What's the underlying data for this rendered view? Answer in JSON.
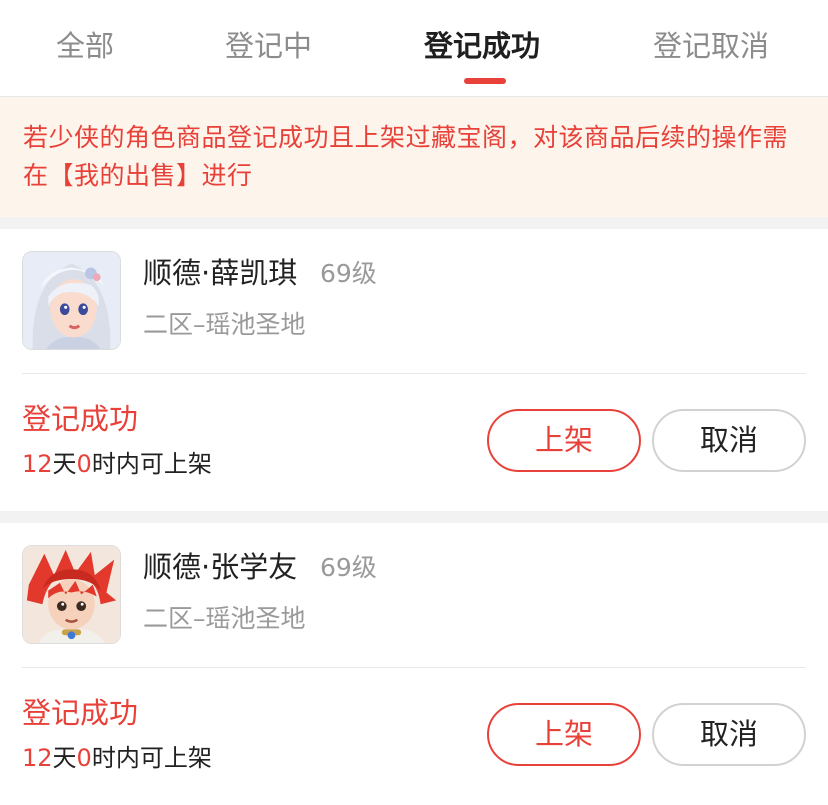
{
  "tabs": [
    {
      "label": "全部"
    },
    {
      "label": "登记中"
    },
    {
      "label": "登记成功"
    },
    {
      "label": "登记取消"
    }
  ],
  "active_tab": "登记成功",
  "notice": {
    "text": "若少侠的角色商品登记成功且上架过藏宝阁，对该商品后续的操作需在【我的出售】进行"
  },
  "items": [
    {
      "name": "顺德·薛凯琪",
      "level": "69级",
      "server": "二区–瑶池圣地",
      "avatar_icon": "female-character-avatar-icon",
      "status": "登记成功",
      "countdown": {
        "days": "12",
        "days_unit": "天",
        "hours": "0",
        "hours_unit": "时内可上架"
      },
      "list_label": "上架",
      "cancel_label": "取消"
    },
    {
      "name": "顺德·张学友",
      "level": "69级",
      "server": "二区–瑶池圣地",
      "avatar_icon": "male-character-avatar-icon",
      "status": "登记成功",
      "countdown": {
        "days": "12",
        "days_unit": "天",
        "hours": "0",
        "hours_unit": "时内可上架"
      },
      "list_label": "上架",
      "cancel_label": "取消"
    }
  ],
  "colors": {
    "accent": "#e8413a",
    "notice_bg": "#fdf5eb",
    "muted_text": "#9a9a9a",
    "separator": "#f2f2f2"
  }
}
